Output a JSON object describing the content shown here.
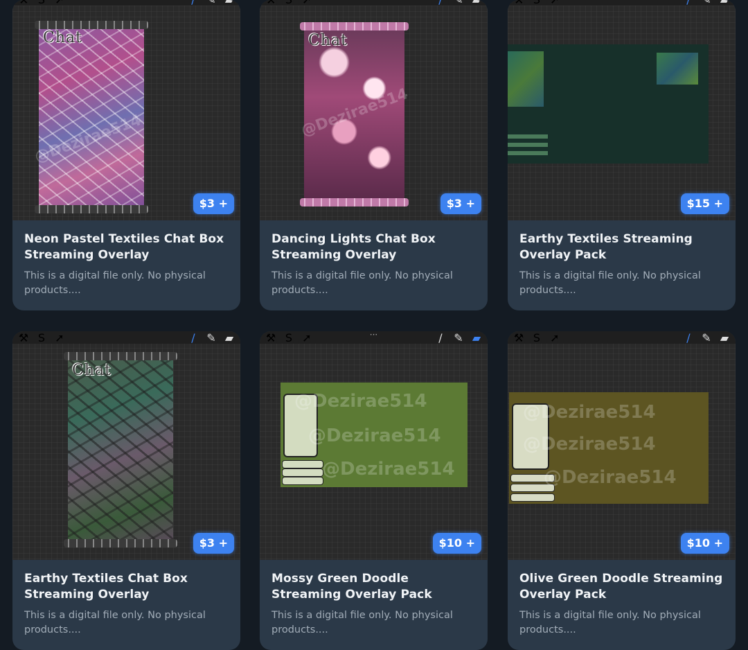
{
  "products": [
    {
      "title": "Neon Pastel Textiles Chat Box Streaming Overlay",
      "description": "This is a digital file only. No physical products....",
      "price": "$3 +"
    },
    {
      "title": "Dancing Lights Chat Box Streaming Overlay",
      "description": "This is a digital file only. No physical products....",
      "price": "$3 +"
    },
    {
      "title": "Earthy Textiles Streaming Overlay Pack",
      "description": "This is a digital file only. No physical products....",
      "price": "$15 +"
    },
    {
      "title": "Earthy Textiles Chat Box Streaming Overlay",
      "description": "This is a digital file only. No physical products....",
      "price": "$3 +"
    },
    {
      "title": "Mossy Green Doodle Streaming Overlay Pack",
      "description": "This is a digital file only. No physical products....",
      "price": "$10 +"
    },
    {
      "title": "Olive Green Doodle Streaming Overlay Pack",
      "description": "This is a digital file only. No physical products....",
      "price": "$10 +"
    }
  ],
  "artwork_text": {
    "chat": "Chat",
    "watermark": "@Dezirae514"
  },
  "colors": {
    "accent": "#3d82f0",
    "card_bg": "#2b3948",
    "page_bg": "#141b23",
    "mossy_green": "#5c7a34",
    "olive_green": "#5d5522"
  }
}
